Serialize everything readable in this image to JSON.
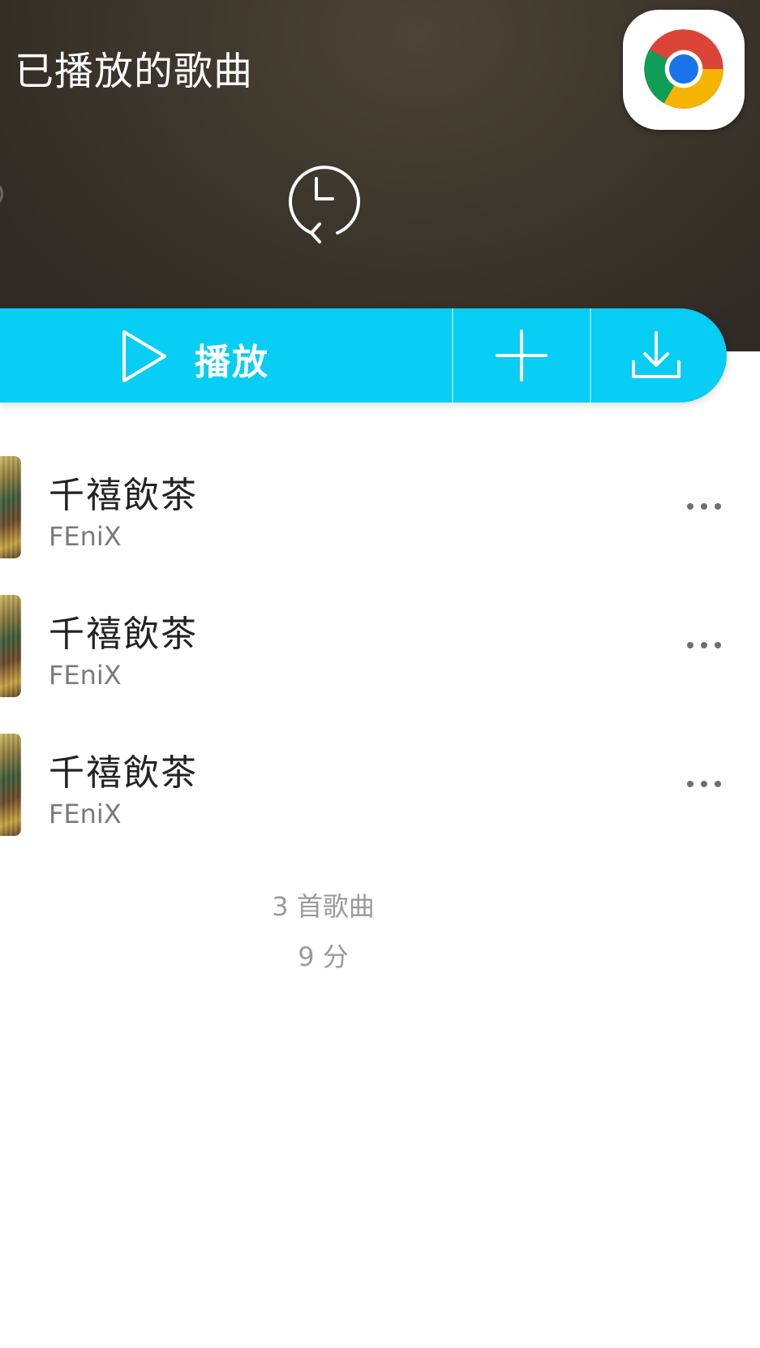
{
  "header": {
    "title": "已播放的歌曲",
    "icon": "history-icon",
    "app_badge_icon": "chrome-icon"
  },
  "action_bar": {
    "play_label": "播放",
    "play_icon": "play-icon",
    "add_icon": "plus-icon",
    "download_icon": "download-icon",
    "accent_color": "#08cdf4"
  },
  "songs": [
    {
      "title": "千禧飲茶",
      "artist": "FEniX"
    },
    {
      "title": "千禧飲茶",
      "artist": "FEniX"
    },
    {
      "title": "千禧飲茶",
      "artist": "FEniX"
    }
  ],
  "summary": {
    "count": "3 首歌曲",
    "duration": "9 分"
  }
}
